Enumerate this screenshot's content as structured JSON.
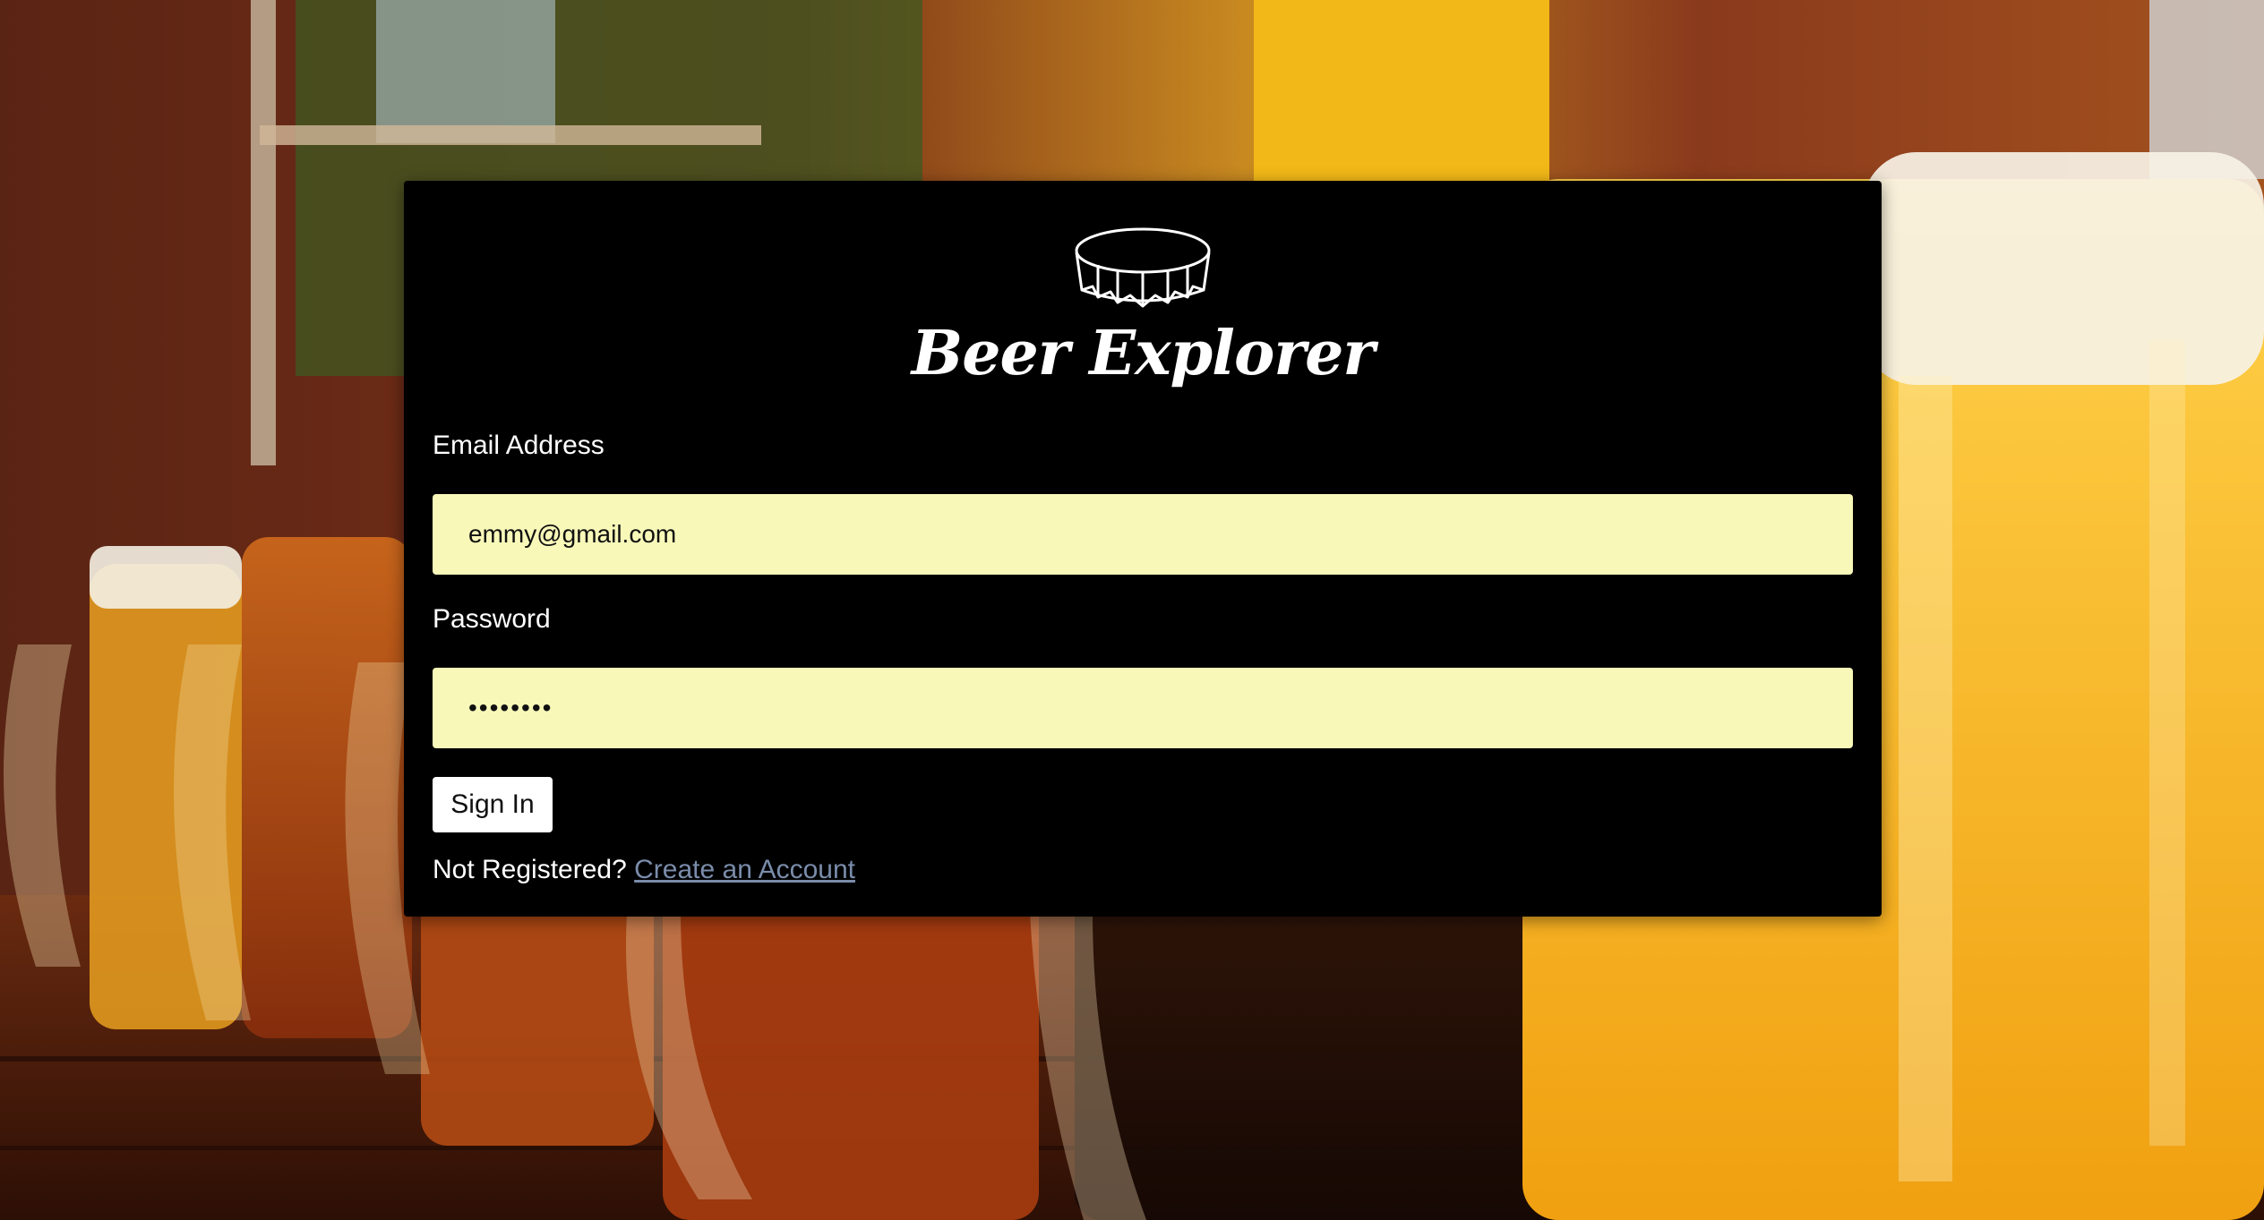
{
  "app": {
    "title": "Beer Explorer"
  },
  "login": {
    "email_label": "Email Address",
    "email_value": "emmy@gmail.com",
    "password_label": "Password",
    "password_value": "••••••••",
    "signin_label": "Sign In",
    "not_registered_text": "Not Registered?",
    "create_account_link": "Create an Account"
  },
  "colors": {
    "card_background": "#000000",
    "field_background": "#f8f8b9",
    "link_color": "#7a8caa"
  },
  "icons": {
    "logo": "bottle-cap-icon"
  }
}
